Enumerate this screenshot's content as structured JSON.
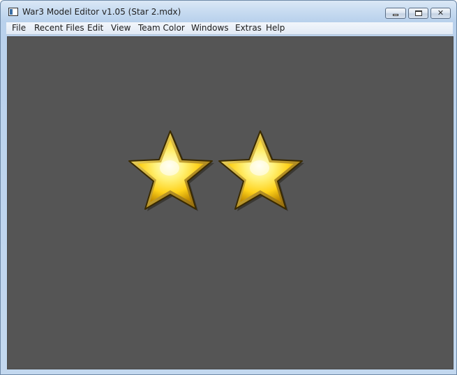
{
  "window": {
    "title": "War3 Model Editor v1.05 (Star 2.mdx)",
    "icon": "app-window-icon",
    "controls": {
      "minimize": "minimize-icon",
      "maximize": "maximize-icon",
      "close_label": "✕"
    }
  },
  "menubar": {
    "items": [
      {
        "label": "File"
      },
      {
        "label": "Recent Files"
      },
      {
        "label": "Edit"
      },
      {
        "label": "View"
      },
      {
        "label": "Team Color"
      },
      {
        "label": "Windows"
      },
      {
        "label": "Extras"
      },
      {
        "label": "Help"
      }
    ]
  },
  "viewport": {
    "background": "#555555",
    "model": {
      "objects": [
        "star",
        "star"
      ],
      "fill_light": "#fffbd0",
      "fill_mid": "#ffe033",
      "fill_dark": "#c08a00",
      "outline": "#3a2a00"
    }
  }
}
